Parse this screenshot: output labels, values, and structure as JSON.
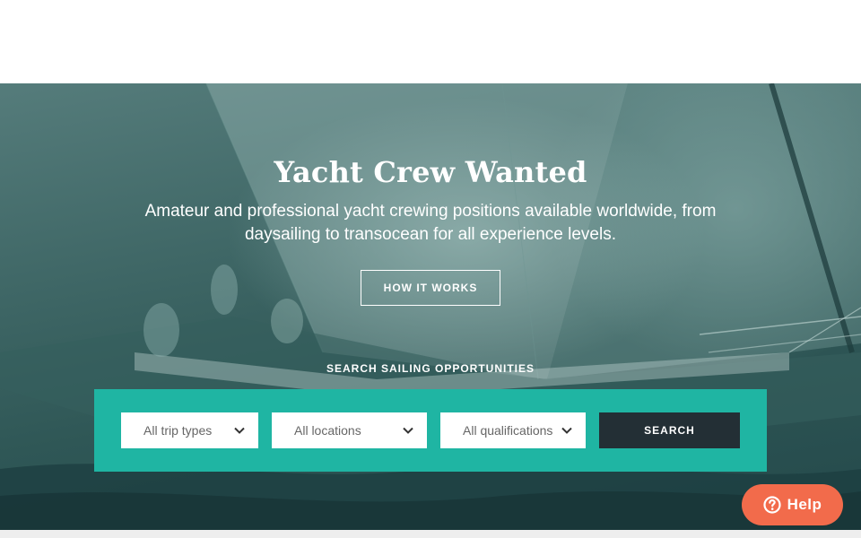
{
  "hero": {
    "title": "Yacht Crew Wanted",
    "subtitle": "Amateur and professional yacht crewing positions available worldwide, from daysailing to transocean for all experience levels.",
    "how_it_works_label": "HOW IT WORKS"
  },
  "search": {
    "heading": "SEARCH SAILING OPPORTUNITIES",
    "trip_type": "All trip types",
    "location": "All locations",
    "qualification": "All qualifications",
    "button_label": "SEARCH"
  },
  "help": {
    "label": "Help",
    "icon": "question-circle-icon"
  },
  "colors": {
    "hero_overlay": "#2f5756",
    "search_panel": "#1fb5a3",
    "search_button": "#232f35",
    "help_button": "#f26b4b"
  }
}
